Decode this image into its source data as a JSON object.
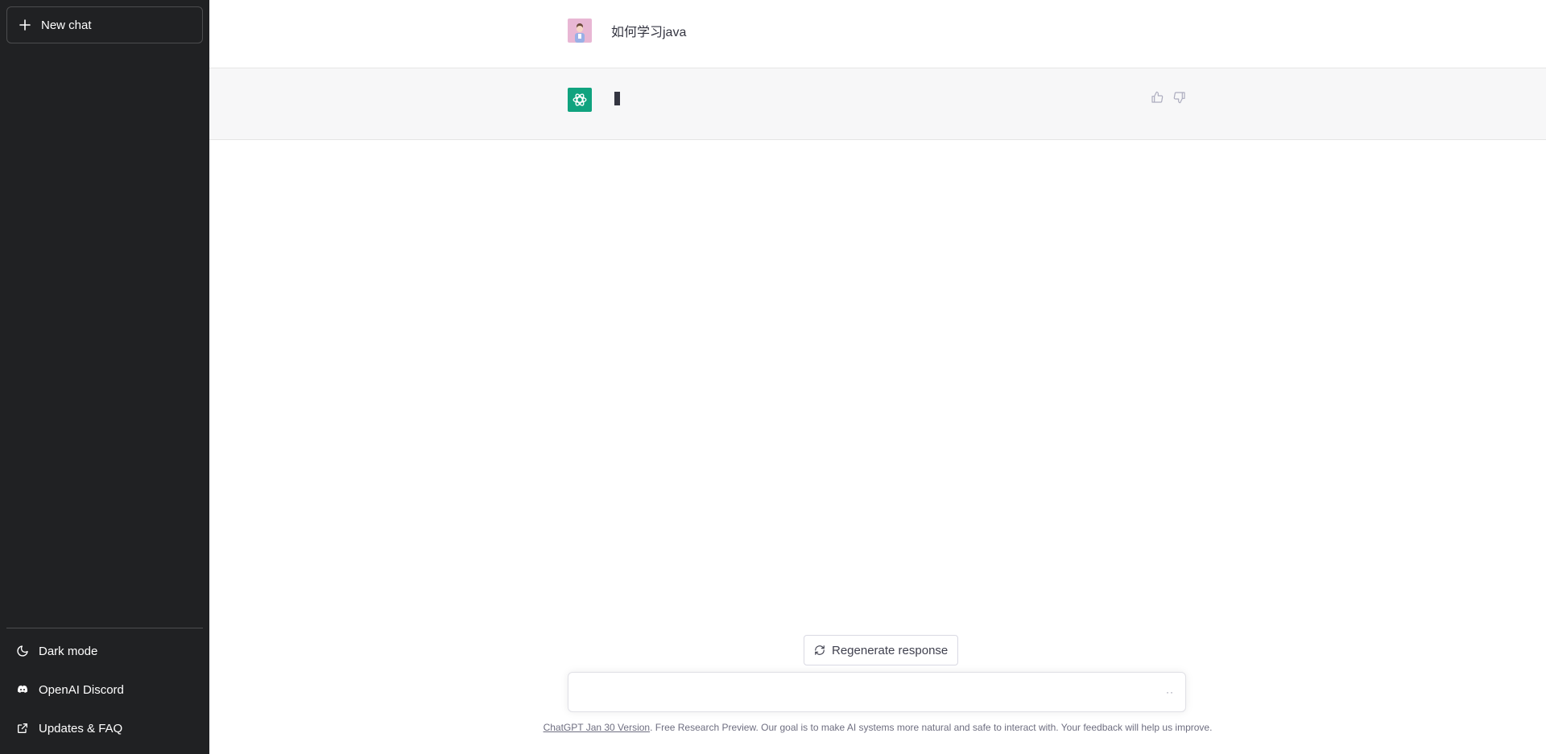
{
  "sidebar": {
    "new_chat_label": "New chat",
    "bottom_items": [
      {
        "label": "Dark mode",
        "icon": "moon-icon"
      },
      {
        "label": "OpenAI Discord",
        "icon": "discord-icon"
      },
      {
        "label": "Updates & FAQ",
        "icon": "external-link-icon"
      }
    ]
  },
  "conversation": {
    "user_message": "如何学习java",
    "assistant_message": ""
  },
  "composer": {
    "regenerate_label": "Regenerate response",
    "input_value": "",
    "more_indicator": "··"
  },
  "footer": {
    "version_link": "ChatGPT Jan 30 Version",
    "note": ". Free Research Preview. Our goal is to make AI systems more natural and safe to interact with. Your feedback will help us improve."
  },
  "colors": {
    "sidebar_bg": "#202123",
    "assistant_row_bg": "#f7f7f8",
    "brand_green": "#10a37f"
  }
}
